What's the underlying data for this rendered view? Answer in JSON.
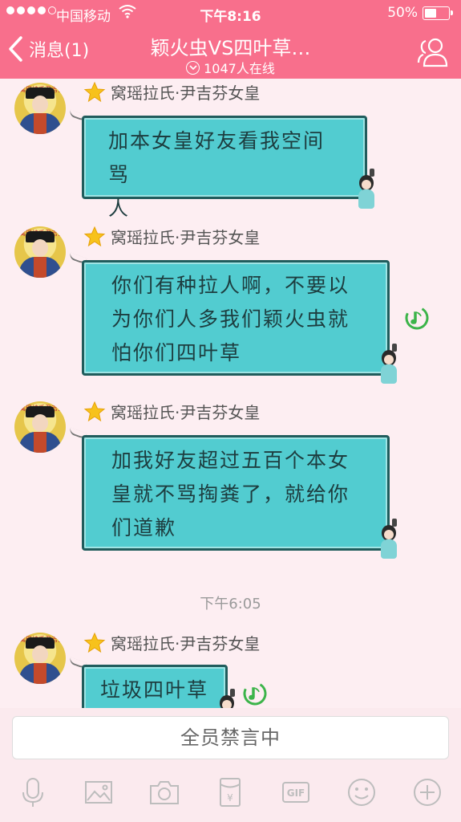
{
  "status_bar": {
    "carrier": "中国移动",
    "time": "下午8:16",
    "battery": "50%"
  },
  "header": {
    "back_label": "消息(1)",
    "title": "颖火虫VS四叶草…",
    "online": "1047人在线"
  },
  "messages": [
    {
      "sender": "窝瑶拉氏·尹吉芬女皇",
      "avatar_tag": "窝瑶拉氏尹吉芬",
      "lines": [
        "加本女皇好友看我空间骂",
        "人"
      ],
      "voice": false
    },
    {
      "sender": "窝瑶拉氏·尹吉芬女皇",
      "avatar_tag": "窝瑶拉氏尹吉芬",
      "lines": [
        "你们有种拉人啊，不要以",
        "为你们人多我们颖火虫就",
        "怕你们四叶草"
      ],
      "voice": true
    },
    {
      "sender": "窝瑶拉氏·尹吉芬女皇",
      "avatar_tag": "窝瑶拉氏尹吉芬",
      "lines": [
        "加我好友超过五百个本女",
        "皇就不骂掏粪了，就给你",
        "们道歉"
      ],
      "voice": false
    },
    {
      "sender": "窝瑶拉氏·尹吉芬女皇",
      "avatar_tag": "窝瑶拉氏尹吉芬",
      "lines": [
        "垃圾四叶草"
      ],
      "voice": true
    }
  ],
  "timestamp": "下午6:05",
  "input": {
    "banned_text": "全员禁言中"
  },
  "toolbar": {
    "gif_label": "GIF",
    "red_packet_label": "¥"
  },
  "colors": {
    "header": "#f86f8c",
    "bubble": "#52ccd0",
    "background": "#fdeef2"
  }
}
